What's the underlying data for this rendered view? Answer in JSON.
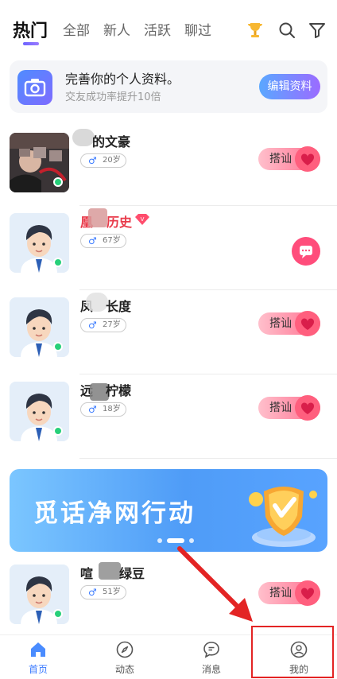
{
  "tabs": [
    {
      "label": "热门",
      "active": true
    },
    {
      "label": "全部"
    },
    {
      "label": "新人"
    },
    {
      "label": "活跃"
    },
    {
      "label": "聊过"
    }
  ],
  "header_icons": [
    "trophy-icon",
    "search-icon",
    "filter-icon"
  ],
  "profile_prompt": {
    "title": "完善你的个人资料。",
    "subtitle": "交友成功率提升10倍",
    "button": "编辑资料"
  },
  "users": [
    {
      "name": "的文豪",
      "age": "20岁",
      "action": "搭讪",
      "online": true
    },
    {
      "name": "历史",
      "age": "67岁",
      "action": "chat",
      "vip": true,
      "online": true
    },
    {
      "name": "长度",
      "age": "27岁",
      "action": "搭讪",
      "online": true
    },
    {
      "name": "柠檬",
      "age": "18岁",
      "action": "搭讪",
      "online": true
    },
    {
      "name": "绿豆",
      "age": "51岁",
      "action": "搭讪",
      "online": true
    }
  ],
  "user_name_prefixes": [
    "",
    "凰",
    "凤",
    "远",
    "喧"
  ],
  "banner": {
    "text": "觅话净网行动",
    "page_count": 3,
    "active_page": 1
  },
  "bottom_nav": [
    {
      "label": "首页",
      "icon": "home-icon",
      "active": true
    },
    {
      "label": "动态",
      "icon": "compass-icon"
    },
    {
      "label": "消息",
      "icon": "message-icon"
    },
    {
      "label": "我的",
      "icon": "profile-icon"
    }
  ],
  "colors": {
    "accent": "#3b7bff",
    "pink": "#ff5f7e",
    "vip_red": "#e83a4a",
    "annotation_red": "#e32424"
  }
}
